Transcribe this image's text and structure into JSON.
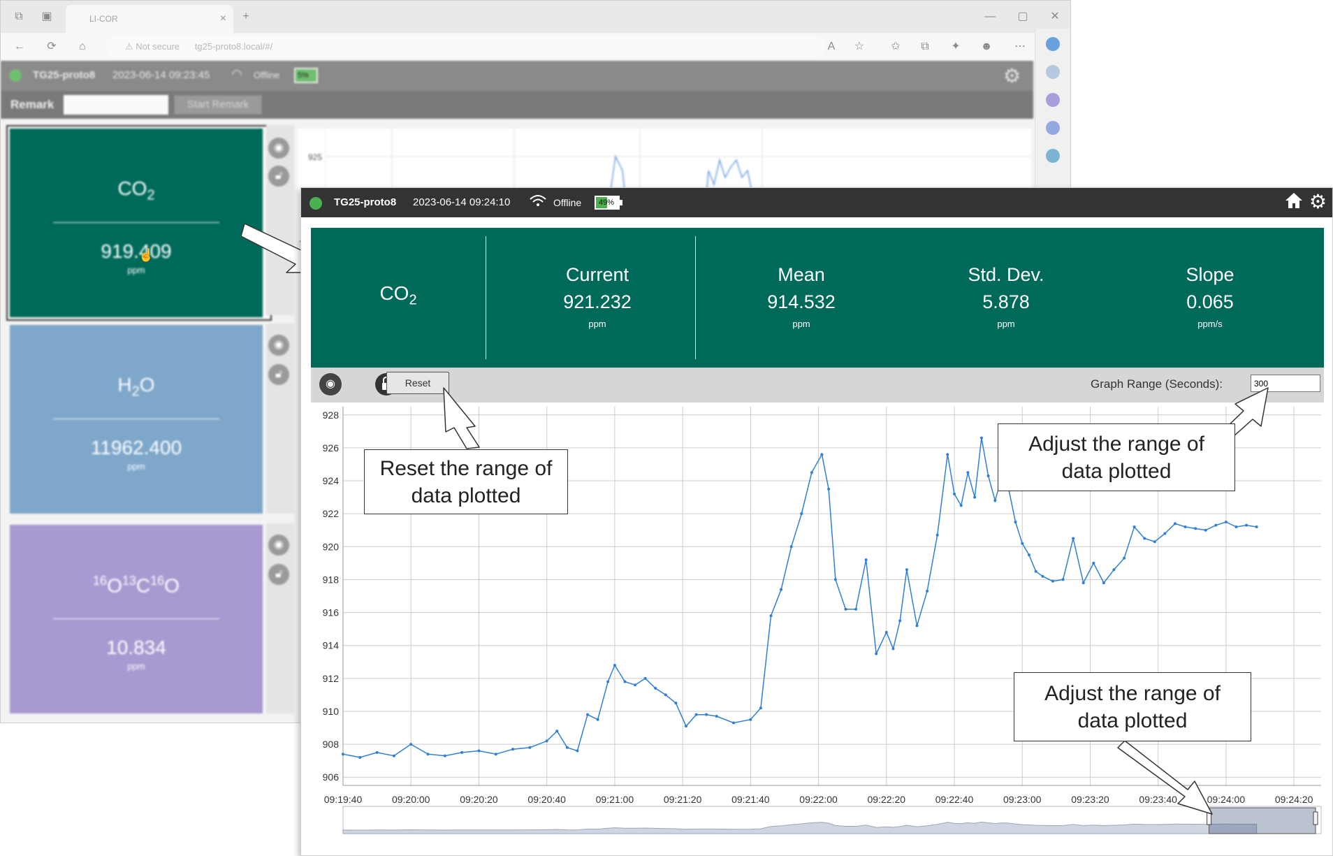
{
  "browser": {
    "tab_title": "LI-COR",
    "security": "Not secure",
    "url": "tg25-proto8.local/#/"
  },
  "background_app": {
    "device_name": "TG25-proto8",
    "timestamp": "2023-06-14 09:23:45",
    "status": "Offline",
    "battery": "5%",
    "remark_label": "Remark",
    "remark_button": "Start Remark",
    "graph_tick": "925",
    "cards": [
      {
        "name": "CO2",
        "value": "919.409",
        "unit": "ppm",
        "color": "#006a5a"
      },
      {
        "name": "H2O",
        "value": "11962.400",
        "unit": "ppm",
        "color": "#7ea7ca"
      },
      {
        "name": "16O13C16O",
        "value": "10.834",
        "unit": "ppm",
        "color": "#a89ad0"
      }
    ]
  },
  "app": {
    "device_name": "TG25-proto8",
    "timestamp": "2023-06-14 09:24:10",
    "status": "Offline",
    "battery": "49%",
    "battery_level": 0.49,
    "accent_color": "#006a5a",
    "gas": "CO2",
    "stats": [
      {
        "label": "Current",
        "value": "921.232",
        "unit": "ppm"
      },
      {
        "label": "Mean",
        "value": "914.532",
        "unit": "ppm"
      },
      {
        "label": "Std. Dev.",
        "value": "5.878",
        "unit": "ppm"
      },
      {
        "label": "Slope",
        "value": "0.065",
        "unit": "ppm/s"
      }
    ],
    "toolbar": {
      "reset_label": "Reset",
      "range_label": "Graph Range (Seconds):",
      "range_value": "300"
    },
    "icons": [
      "broadcast-icon",
      "unlock-icon",
      "home-icon",
      "gear-icon",
      "wifi-icon"
    ]
  },
  "callouts": {
    "reset": "Reset the range of data plotted",
    "range_input": "Adjust the range of data plotted",
    "range_slider": "Adjust the range of data plotted"
  },
  "chart_data": {
    "type": "line",
    "line_color": "#2f7fd6",
    "grid": true,
    "xlabel": "",
    "ylabel": "",
    "ylim": [
      905.5,
      928.5
    ],
    "yticks": [
      906,
      908,
      910,
      912,
      914,
      916,
      918,
      920,
      922,
      924,
      926,
      928
    ],
    "xlim": [
      "09:19:40",
      "09:24:28"
    ],
    "xticks": [
      "09:19:40",
      "09:20:00",
      "09:20:20",
      "09:20:40",
      "09:21:00",
      "09:21:20",
      "09:21:40",
      "09:22:00",
      "09:22:20",
      "09:22:40",
      "09:23:00",
      "09:23:20",
      "09:23:40",
      "09:24:00",
      "09:24:20"
    ],
    "series": [
      {
        "x": [
          "09:19:40",
          "09:19:45",
          "09:19:50",
          "09:19:55",
          "09:20:00",
          "09:20:05",
          "09:20:10",
          "09:20:15",
          "09:20:20",
          "09:20:25",
          "09:20:30",
          "09:20:35",
          "09:20:40",
          "09:20:43",
          "09:20:46",
          "09:20:49",
          "09:20:52",
          "09:20:55",
          "09:20:58",
          "09:21:00",
          "09:21:03",
          "09:21:06",
          "09:21:09",
          "09:21:12",
          "09:21:15",
          "09:21:18",
          "09:21:21",
          "09:21:24",
          "09:21:27",
          "09:21:30",
          "09:21:35",
          "09:21:40",
          "09:21:43",
          "09:21:46",
          "09:21:49",
          "09:21:52",
          "09:21:55",
          "09:21:58",
          "09:22:01",
          "09:22:03",
          "09:22:05",
          "09:22:08",
          "09:22:11",
          "09:22:14",
          "09:22:17",
          "09:22:20",
          "09:22:22",
          "09:22:24",
          "09:22:26",
          "09:22:29",
          "09:22:32",
          "09:22:35",
          "09:22:38",
          "09:22:40",
          "09:22:42",
          "09:22:44",
          "09:22:46",
          "09:22:48",
          "09:22:50",
          "09:22:52",
          "09:22:54",
          "09:22:56",
          "09:22:58",
          "09:23:00",
          "09:23:02",
          "09:23:04",
          "09:23:06",
          "09:23:09",
          "09:23:12",
          "09:23:15",
          "09:23:18",
          "09:23:21",
          "09:23:24",
          "09:23:27",
          "09:23:30",
          "09:23:33",
          "09:23:36",
          "09:23:39",
          "09:23:42",
          "09:23:45",
          "09:23:48",
          "09:23:51",
          "09:23:54",
          "09:23:57",
          "09:24:00",
          "09:24:03",
          "09:24:06",
          "09:24:09"
        ],
        "y": [
          907.4,
          907.2,
          907.5,
          907.3,
          908.0,
          907.4,
          907.3,
          907.5,
          907.6,
          907.4,
          907.7,
          907.8,
          908.2,
          908.8,
          907.8,
          907.6,
          909.8,
          909.5,
          911.8,
          912.8,
          911.8,
          911.6,
          912.0,
          911.4,
          911.0,
          910.5,
          909.1,
          909.8,
          909.8,
          909.7,
          909.3,
          909.5,
          910.2,
          915.8,
          917.4,
          920.0,
          922.0,
          924.5,
          925.6,
          923.5,
          918.0,
          916.2,
          916.2,
          919.2,
          913.5,
          914.8,
          913.8,
          915.5,
          918.6,
          915.2,
          917.3,
          920.7,
          925.6,
          923.2,
          922.5,
          924.5,
          923.0,
          926.6,
          924.3,
          922.8,
          924.2,
          923.5,
          921.5,
          920.2,
          919.5,
          918.5,
          918.2,
          917.9,
          918.0,
          920.5,
          917.8,
          919.0,
          917.8,
          918.6,
          919.3,
          921.2,
          920.5,
          920.3,
          920.8,
          921.4,
          921.2,
          921.1,
          921.0,
          921.3,
          921.5,
          921.2,
          921.3,
          921.2
        ]
      }
    ]
  }
}
